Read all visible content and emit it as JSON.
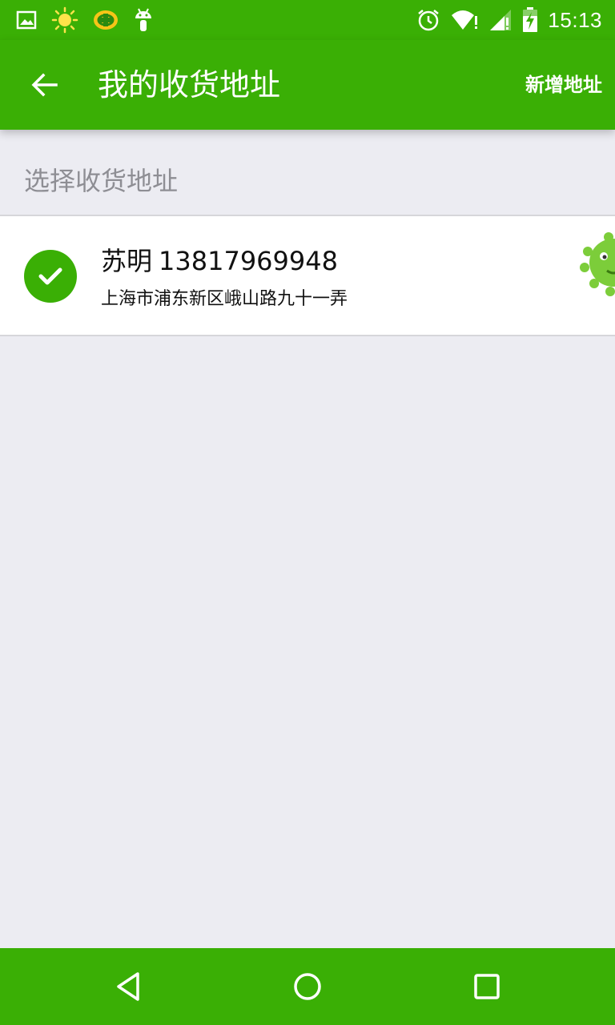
{
  "status_bar": {
    "time": "15:13",
    "left_icons": [
      "image-icon",
      "weather-sun-icon",
      "security-app-icon",
      "android-icon"
    ],
    "right_icons": [
      "alarm-icon",
      "wifi-icon",
      "signal-icon",
      "battery-charging-icon"
    ]
  },
  "toolbar": {
    "back_icon": "arrow-left-icon",
    "title": "我的收货地址",
    "action_label": "新增地址"
  },
  "section": {
    "label": "选择收货地址"
  },
  "addresses": [
    {
      "selected": true,
      "name": "苏明",
      "phone": "13817969948",
      "address": "上海市浦东新区峨山路九十一弄"
    }
  ],
  "nav_bar": {
    "buttons": [
      "back-triangle-icon",
      "home-circle-icon",
      "recents-square-icon"
    ]
  },
  "colors": {
    "brand_green": "#3aaf05",
    "background": "#ececf2",
    "section_text": "#8e8e94"
  }
}
